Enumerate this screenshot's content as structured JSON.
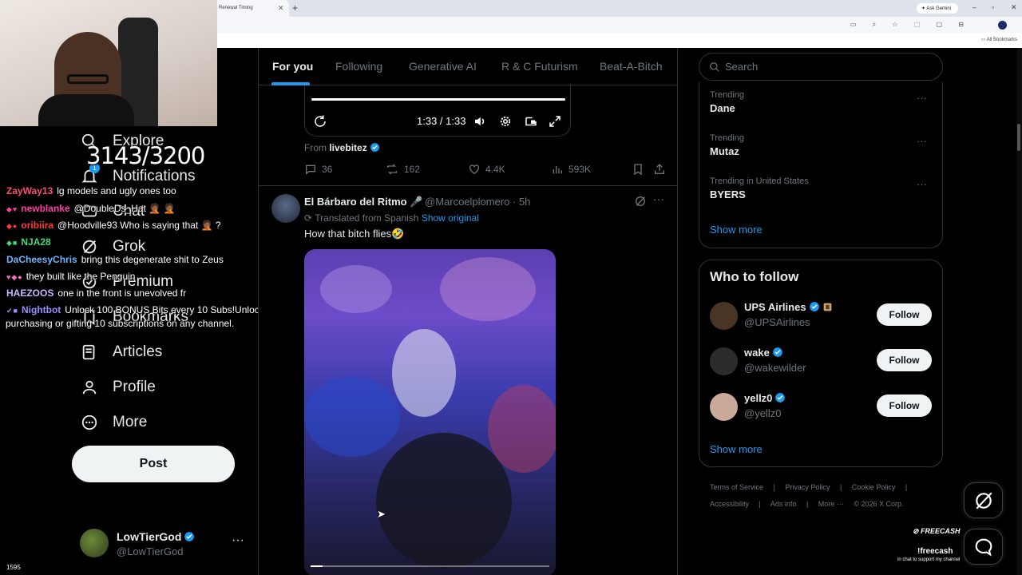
{
  "browser": {
    "tab_title": "Renewal Timing",
    "ask_gemini": "Ask Gemini",
    "all_bookmarks": "All Bookmarks"
  },
  "stream": {
    "sub_counter": "3143/3200",
    "notification_badge": "1",
    "chat": [
      {
        "user": "ZayWay13",
        "user_color": "#ff4d6d",
        "badges": "",
        "message": "lg models and ugly ones too"
      },
      {
        "user": "newblanke",
        "user_color": "#ff3ea5",
        "badges": "◆♥",
        "message": "@DoubleDs_Hat 🤦🏾 🤦🏾"
      },
      {
        "user": "oribiira",
        "user_color": "#ff3b3b",
        "badges": "◆●",
        "message": "@Hoodville93 Who is saying that 🤦🏾 ?"
      },
      {
        "user": "NJA28",
        "user_color": "#3fd97a",
        "badges": "◆■",
        "message": ""
      },
      {
        "user": "DaCheesyChris",
        "user_color": "#6ab7ff",
        "badges": "",
        "message": "bring this degenerate shit to Zeus"
      },
      {
        "user": "",
        "user_color": "#ff6ec7",
        "badges": "♥◆●",
        "message": "they built like the Penguin"
      },
      {
        "user": "HAEZOOS",
        "user_color": "#c9b6ff",
        "badges": "",
        "message": "one in the front is unevolved fr"
      },
      {
        "user": "Nightbot",
        "user_color": "#9b8cff",
        "badges": "✔■",
        "message": "Unlock 100 BONUS Bits every 10 Subs!Unlock Bits by"
      },
      {
        "user": "",
        "user_color": "#ffffff",
        "badges": "",
        "message": "purchasing or gifting 10 subscriptions on any channel."
      }
    ],
    "viewer_count": "1595",
    "freecash_logo": "FREECASH",
    "freecash_command": "!freecash",
    "freecash_sub": "in chat to support my channel"
  },
  "nav": {
    "items": [
      {
        "label": "Explore",
        "icon": "search-icon"
      },
      {
        "label": "Notifications",
        "icon": "bell-icon"
      },
      {
        "label": "Chat",
        "icon": "chat-icon"
      },
      {
        "label": "Grok",
        "icon": "grok-icon"
      },
      {
        "label": "Premium",
        "icon": "premium-icon"
      },
      {
        "label": "Bookmarks",
        "icon": "bookmark-icon"
      },
      {
        "label": "Articles",
        "icon": "articles-icon"
      },
      {
        "label": "Profile",
        "icon": "profile-icon"
      },
      {
        "label": "More",
        "icon": "more-circle-icon"
      }
    ],
    "post_button": "Post",
    "account": {
      "name": "LowTierGod",
      "handle": "@LowTierGod",
      "more": "···"
    }
  },
  "feed": {
    "tabs": [
      "For you",
      "Following",
      "Generative AI",
      "R & C Futurism",
      "Beat-A-Bitch"
    ],
    "active_tab": 0,
    "post1": {
      "video_time": "1:33 / 1:33",
      "from_label": "From",
      "from_account": "livebitez",
      "replies": "36",
      "reposts": "162",
      "likes": "4.4K",
      "views": "593K"
    },
    "post2": {
      "name": "El Bárbaro del Ritmo 🎤",
      "handle": "@Marcoelplomero · 5h",
      "translated": "Translated from Spanish",
      "show_original": "Show original",
      "text": "How that bitch flies🤣",
      "more": "···",
      "video_progress": 0.05
    }
  },
  "sidebar": {
    "search_placeholder": "Search",
    "trends": [
      {
        "context": "Trending",
        "name": "Dane"
      },
      {
        "context": "Trending",
        "name": "Mutaz"
      },
      {
        "context": "Trending in United States",
        "name": "BYERS"
      }
    ],
    "trend_more": "···",
    "show_more": "Show more",
    "who_to_follow_title": "Who to follow",
    "follow_suggestions": [
      {
        "name": "UPS Airlines",
        "handle": "@UPSAirlines",
        "button": "Follow",
        "avatar_color": "#4a3424"
      },
      {
        "name": "wake",
        "handle": "@wakewilder",
        "button": "Follow",
        "avatar_color": "#2c2c2c"
      },
      {
        "name": "yellz0",
        "handle": "@yellz0",
        "button": "Follow",
        "avatar_color": "#c9a99a"
      }
    ],
    "footer_row1": [
      "Terms of Service",
      "|",
      "Privacy Policy",
      "|",
      "Cookie Policy",
      "|"
    ],
    "footer_row2": [
      "Accessibility",
      "|",
      "Ads info",
      "|",
      "More ···",
      "© 2026 X Corp."
    ]
  },
  "colors": {
    "accent": "#1d9bf0",
    "background": "#000000",
    "text": "#e7e9ea",
    "muted": "#71767b"
  }
}
